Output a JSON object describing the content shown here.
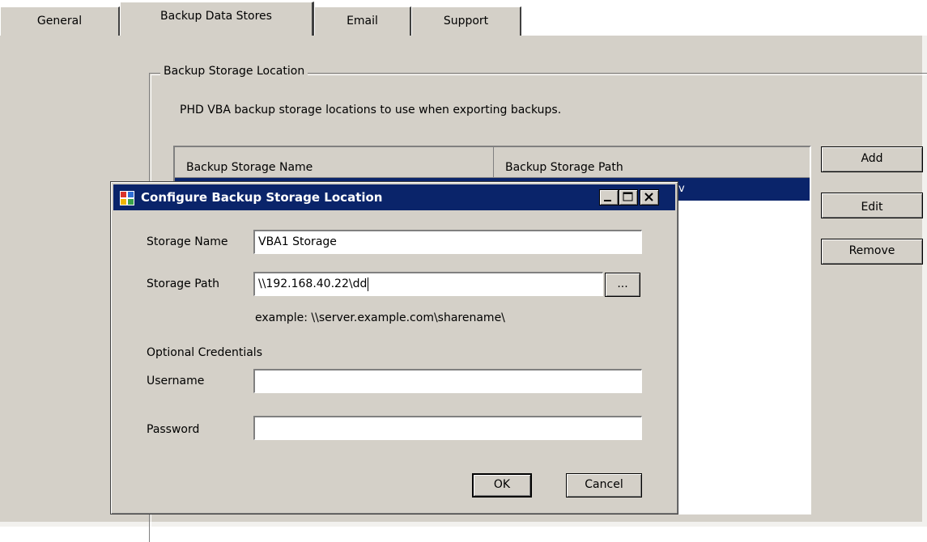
{
  "tabs": [
    {
      "label": "General"
    },
    {
      "label": "Backup Data Stores"
    },
    {
      "label": "Email"
    },
    {
      "label": "Support"
    }
  ],
  "group": {
    "legend": "Backup Storage Location",
    "description": "PHD VBA backup storage locations to use when exporting backups."
  },
  "list": {
    "columns": [
      "Backup Storage Name",
      "Backup Storage Path"
    ],
    "selected_row_fragment": "v"
  },
  "side_buttons": {
    "add": "Add",
    "edit": "Edit",
    "remove": "Remove"
  },
  "dialog": {
    "title": "Configure Backup Storage Location",
    "storage_name_label": "Storage Name",
    "storage_name_value": "VBA1 Storage",
    "storage_path_label": "Storage Path",
    "storage_path_value": "\\\\192.168.40.22\\dd",
    "browse_label": "...",
    "example_text": "example: \\\\server.example.com\\sharename\\",
    "optional_credentials": "Optional Credentials",
    "username_label": "Username",
    "username_value": "",
    "password_label": "Password",
    "password_value": "",
    "ok_label": "OK",
    "cancel_label": "Cancel"
  },
  "colors": {
    "face": "#d4d0c8",
    "selection": "#0a246a"
  }
}
